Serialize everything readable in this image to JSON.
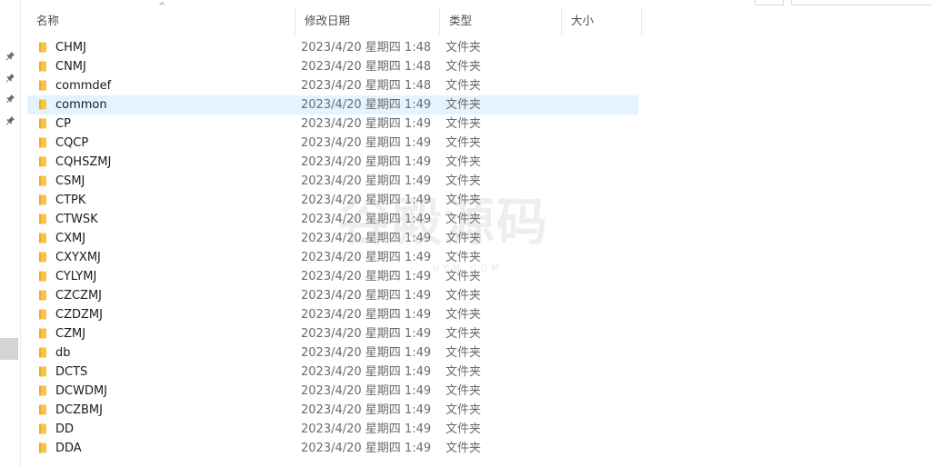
{
  "columns": {
    "name": "名称",
    "modified": "修改日期",
    "type": "类型",
    "size": "大小"
  },
  "sort_indicator": "^",
  "icons": {
    "folder": "folder-icon",
    "pin": "pin-icon",
    "folder_color": "#f6c544",
    "folder_dark": "#e8ab2a"
  },
  "selection_color": "#e5f3ff",
  "files": [
    {
      "name": "CHMJ",
      "modified": "2023/4/20 星期四 1:48",
      "type": "文件夹",
      "size": ""
    },
    {
      "name": "CNMJ",
      "modified": "2023/4/20 星期四 1:48",
      "type": "文件夹",
      "size": ""
    },
    {
      "name": "commdef",
      "modified": "2023/4/20 星期四 1:48",
      "type": "文件夹",
      "size": ""
    },
    {
      "name": "common",
      "modified": "2023/4/20 星期四 1:49",
      "type": "文件夹",
      "size": "",
      "selected": true
    },
    {
      "name": "CP",
      "modified": "2023/4/20 星期四 1:49",
      "type": "文件夹",
      "size": ""
    },
    {
      "name": "CQCP",
      "modified": "2023/4/20 星期四 1:49",
      "type": "文件夹",
      "size": ""
    },
    {
      "name": "CQHSZMJ",
      "modified": "2023/4/20 星期四 1:49",
      "type": "文件夹",
      "size": ""
    },
    {
      "name": "CSMJ",
      "modified": "2023/4/20 星期四 1:49",
      "type": "文件夹",
      "size": ""
    },
    {
      "name": "CTPK",
      "modified": "2023/4/20 星期四 1:49",
      "type": "文件夹",
      "size": ""
    },
    {
      "name": "CTWSK",
      "modified": "2023/4/20 星期四 1:49",
      "type": "文件夹",
      "size": ""
    },
    {
      "name": "CXMJ",
      "modified": "2023/4/20 星期四 1:49",
      "type": "文件夹",
      "size": ""
    },
    {
      "name": "CXYXMJ",
      "modified": "2023/4/20 星期四 1:49",
      "type": "文件夹",
      "size": ""
    },
    {
      "name": "CYLYMJ",
      "modified": "2023/4/20 星期四 1:49",
      "type": "文件夹",
      "size": ""
    },
    {
      "name": "CZCZMJ",
      "modified": "2023/4/20 星期四 1:49",
      "type": "文件夹",
      "size": ""
    },
    {
      "name": "CZDZMJ",
      "modified": "2023/4/20 星期四 1:49",
      "type": "文件夹",
      "size": ""
    },
    {
      "name": "CZMJ",
      "modified": "2023/4/20 星期四 1:49",
      "type": "文件夹",
      "size": ""
    },
    {
      "name": "db",
      "modified": "2023/4/20 星期四 1:49",
      "type": "文件夹",
      "size": ""
    },
    {
      "name": "DCTS",
      "modified": "2023/4/20 星期四 1:49",
      "type": "文件夹",
      "size": ""
    },
    {
      "name": "DCWDMJ",
      "modified": "2023/4/20 星期四 1:49",
      "type": "文件夹",
      "size": ""
    },
    {
      "name": "DCZBMJ",
      "modified": "2023/4/20 星期四 1:49",
      "type": "文件夹",
      "size": ""
    },
    {
      "name": "DD",
      "modified": "2023/4/20 星期四 1:49",
      "type": "文件夹",
      "size": ""
    },
    {
      "name": "DDA",
      "modified": "2023/4/20 星期四 1:49",
      "type": "文件夹",
      "size": ""
    }
  ],
  "watermark": {
    "main": "谷殿源码",
    "sub": "UYM.COM"
  }
}
